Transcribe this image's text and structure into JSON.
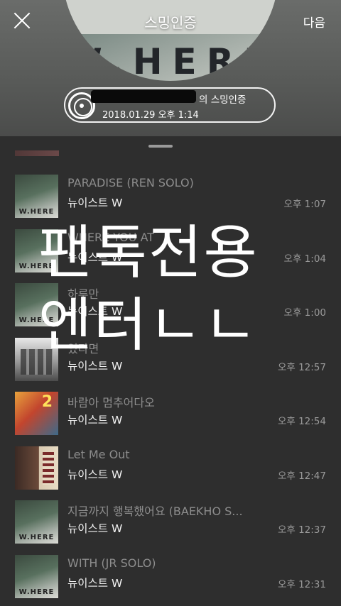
{
  "header": {
    "album_title": "스밍인증",
    "album_watermark": "W.HERE",
    "next_label": "다음",
    "cert_suffix": "의 스밍인증",
    "cert_timestamp": "2018.01.29 오후 1:14"
  },
  "tracks": [
    {
      "title": "PARADISE (REN SOLO)",
      "artist": "뉴이스트 W",
      "time": "오후 1:07",
      "art": "where"
    },
    {
      "title": "WHERE YOU AT",
      "artist": "뉴이스트 W",
      "time": "오후 1:04",
      "art": "where"
    },
    {
      "title": "하루만",
      "artist": "뉴이스트 W",
      "time": "오후 1:00",
      "art": "where"
    },
    {
      "title": "있다면",
      "artist": "뉴이스트 W",
      "time": "오후 12:57",
      "art": "bw"
    },
    {
      "title": "바람아 멈추어다오",
      "artist": "뉴이스트 W",
      "time": "오후 12:54",
      "art": "orange"
    },
    {
      "title": "Let Me Out",
      "artist": "뉴이스트 W",
      "time": "오후 12:47",
      "art": "dark"
    },
    {
      "title": "지금까지 행복했어요 (BAEKHO S...",
      "artist": "뉴이스트 W",
      "time": "오후 12:37",
      "art": "where"
    },
    {
      "title": "WITH (JR SOLO)",
      "artist": "뉴이스트 W",
      "time": "오후 12:31",
      "art": "where"
    }
  ],
  "overlay": {
    "line1": "팬톡전용",
    "line2": "엔터ㄴㄴ"
  }
}
